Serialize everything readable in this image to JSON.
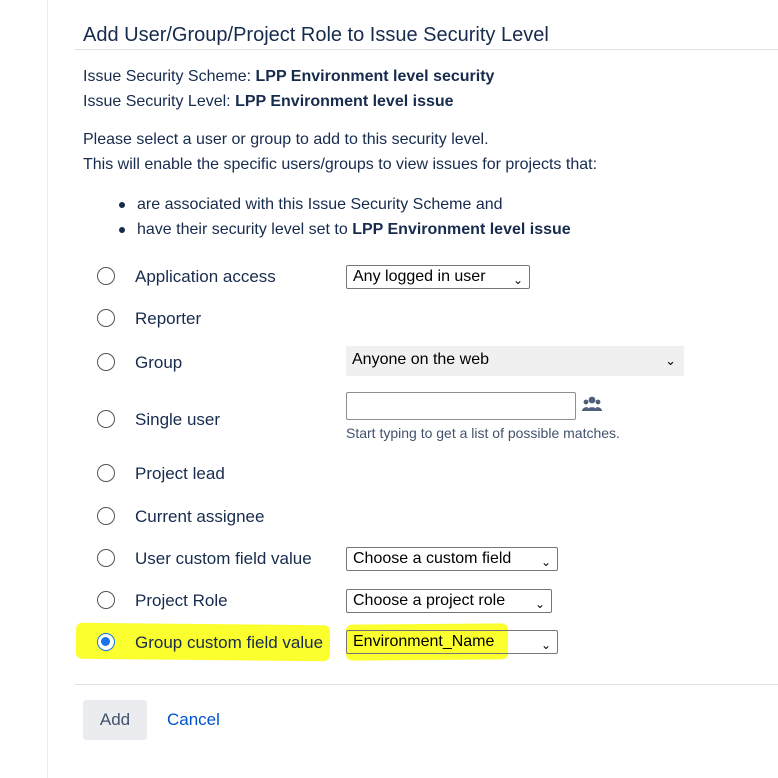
{
  "dialog": {
    "title": "Add User/Group/Project Role to Issue Security Level",
    "scheme_label": "Issue Security Scheme:",
    "scheme_value": "LPP Environment level security",
    "level_label": "Issue Security Level:",
    "level_value": "LPP Environment level issue",
    "intro_line1": "Please select a user or group to add to this security level.",
    "intro_line2": "This will enable the specific users/groups to view issues for projects that:",
    "bullet1": "are associated with this Issue Security Scheme and",
    "bullet2_prefix": "have their security level set to",
    "bullet2_value": "LPP Environment level issue"
  },
  "options": {
    "application_access": {
      "label": "Application access",
      "select": "Any logged in user"
    },
    "reporter": {
      "label": "Reporter"
    },
    "group": {
      "label": "Group",
      "select": "Anyone on the web"
    },
    "single_user": {
      "label": "Single user",
      "value": "",
      "hint": "Start typing to get a list of possible matches."
    },
    "project_lead": {
      "label": "Project lead"
    },
    "current_assignee": {
      "label": "Current assignee"
    },
    "user_custom_field": {
      "label": "User custom field value",
      "select": "Choose a custom field"
    },
    "project_role": {
      "label": "Project Role",
      "select": "Choose a project role"
    },
    "group_custom_field": {
      "label": "Group custom field value",
      "select": "Environment_Name",
      "selected": true
    }
  },
  "actions": {
    "add_label": "Add",
    "cancel_label": "Cancel"
  },
  "colors": {
    "highlight": "#fcff2e",
    "link": "#0052cc",
    "text": "#172b4d",
    "radio_selected": "#1a73e8"
  },
  "icons": {
    "user_picker": "users-icon",
    "dropdown": "chevron-down-icon"
  }
}
